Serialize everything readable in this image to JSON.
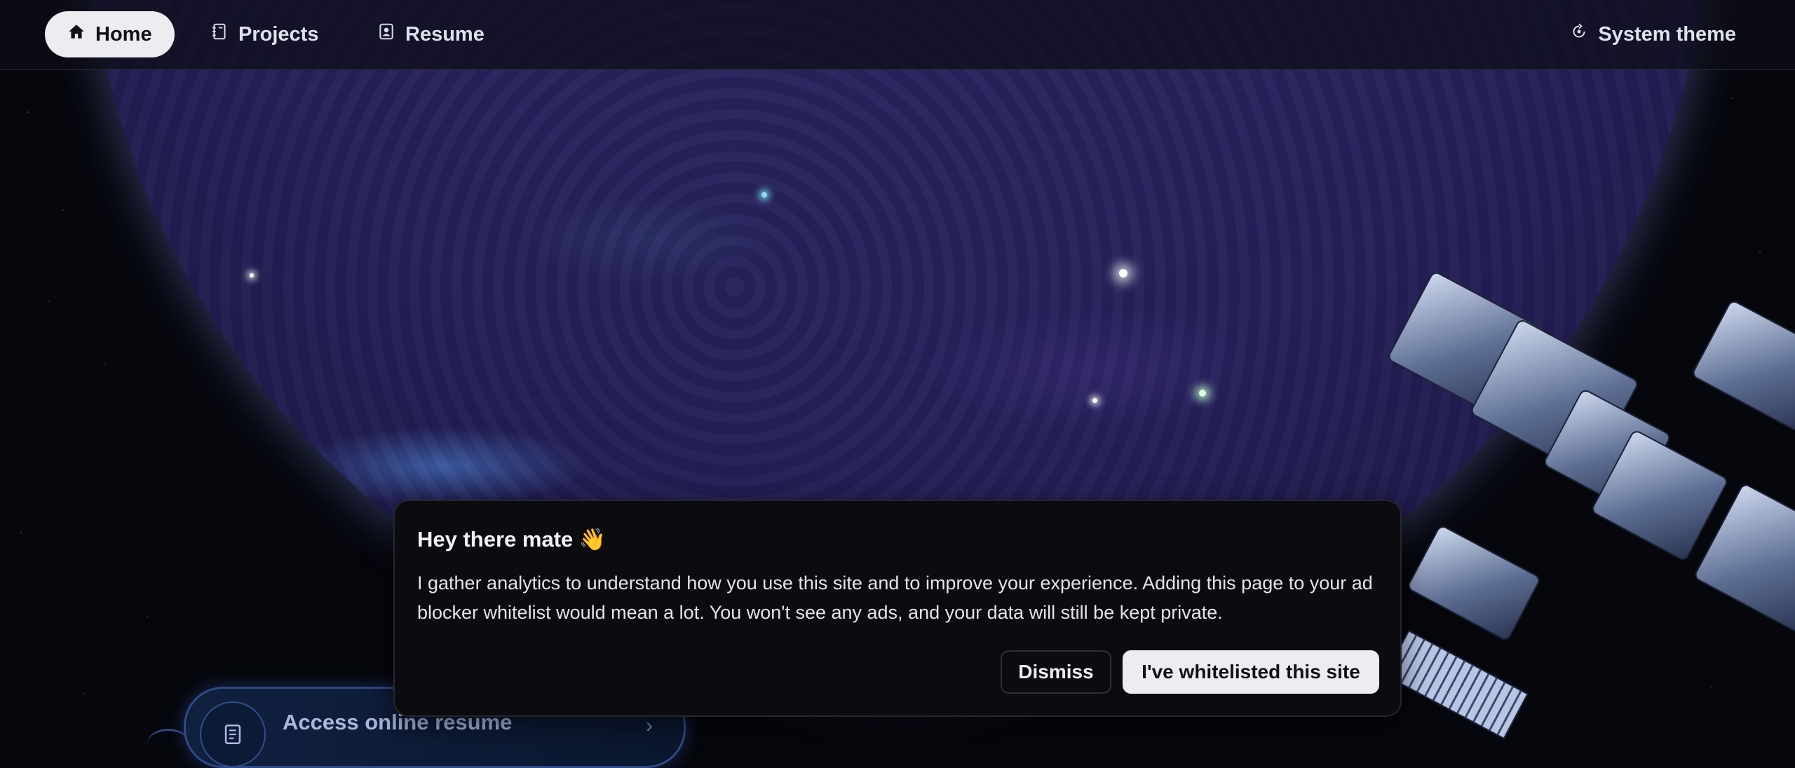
{
  "nav": {
    "items": [
      {
        "label": "Home",
        "icon": "home-icon",
        "active": true
      },
      {
        "label": "Projects",
        "icon": "notebook-icon",
        "active": false
      },
      {
        "label": "Resume",
        "icon": "id-badge-icon",
        "active": false
      }
    ],
    "theme": {
      "label": "System theme",
      "icon": "theme-icon"
    }
  },
  "dialog": {
    "title": "Hey there mate 👋",
    "body": "I gather analytics to understand how you use this site and to improve your experience. Adding this page to your ad blocker whitelist would mean a lot. You won't see any ads, and your data will still be kept private.",
    "dismiss_label": "Dismiss",
    "whitelist_label": "I've whitelisted this site"
  },
  "resume_link": {
    "label": "Access online resume",
    "icon": "document-icon",
    "chevron": "›"
  },
  "colors": {
    "nav_active_bg": "#ececf1",
    "dialog_bg": "#0b0b10",
    "resume_accent": "#2e4a86"
  }
}
